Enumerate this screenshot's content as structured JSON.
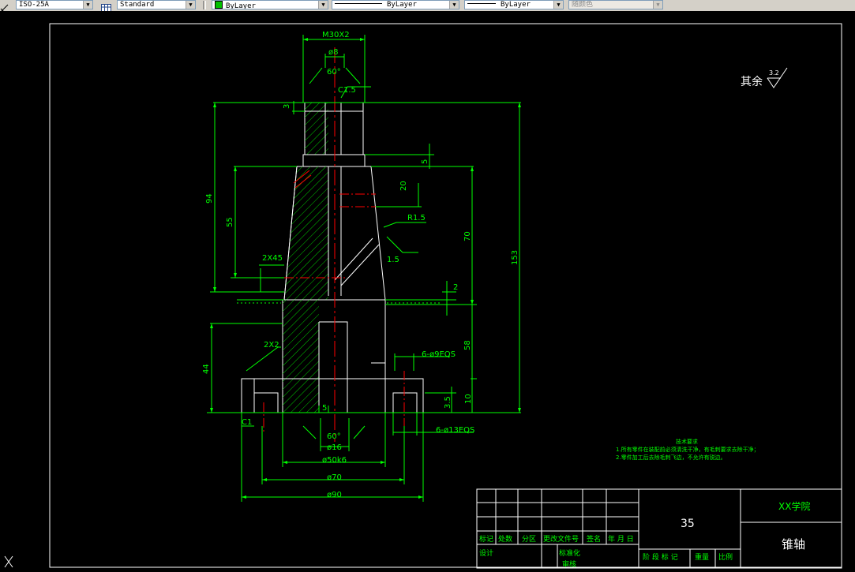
{
  "toolbar": {
    "dimstyle_value": "ISO-25A",
    "tablestyle_value": "Standard",
    "layer_color_value": "ByLayer",
    "linetype_value": "ByLayer",
    "lineweight_value": "ByLayer",
    "plotstyle_value": "随颜色"
  },
  "drawing": {
    "roughness_label": "其余",
    "roughness_value": "3.2",
    "dims": {
      "m30": "M30X2",
      "d8": "ø8",
      "a60_top": "60°",
      "c15": "C1.5",
      "v3": "3",
      "v5": "5",
      "v94": "94",
      "v20": "20",
      "v55": "55",
      "r15": "R1.5",
      "v70": "70",
      "v153": "153",
      "v15": "1.5",
      "ch2": "2X45",
      "v58": "58",
      "v2": "2",
      "v44": "44",
      "c2": "2X2",
      "holes_small": "6-ø9EQS",
      "v35": "3.5",
      "v10": "10",
      "c1": "C1",
      "v5b": "5",
      "holes_large": "6-ø13EQS",
      "a60_bot": "60°",
      "d16": "ø16",
      "d50": "ø50k6",
      "d70": "ø70",
      "d90": "ø90"
    },
    "notes": {
      "title": "技术要求",
      "line1": "1.所有零件在装配前必须清洗干净，有毛刺要求去除干净；",
      "line2": "2.零件加工后去除毛刺飞边，不允许有锐边。"
    },
    "title_block": {
      "labels": [
        "标记",
        "处数",
        "分区",
        "更改文件号",
        "签名",
        "年 月 日"
      ],
      "design": "设计",
      "standard": "标准化",
      "review": "审核",
      "stage": "阶 段 标 记",
      "weight": "重量",
      "scale": "比例",
      "material": "35",
      "school": "XX学院",
      "part_name": "锥轴"
    }
  },
  "colors": {
    "green": "#00ff00",
    "red": "#ff0000",
    "white": "#ffffff",
    "hatch": "#00c800"
  }
}
